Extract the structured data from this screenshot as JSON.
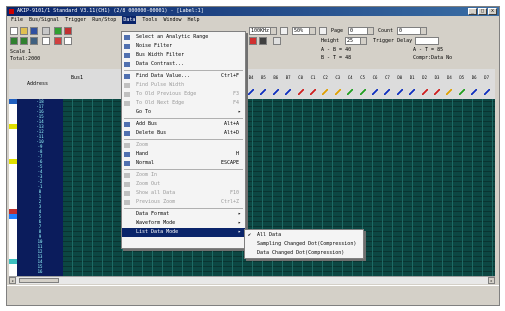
{
  "window": {
    "title": "AKIP-9101/1 Standard V3.11(CH1) (2/8 000000-00001) - [Label:1]",
    "min": "_",
    "max": "□",
    "close": "x"
  },
  "menubar": [
    "File",
    "Bus/Signal",
    "Trigger",
    "Run/Stop",
    "Data",
    "Tools",
    "Window",
    "Help"
  ],
  "toolbar": {
    "freq": "100KHz",
    "zoom": "50%",
    "page_label": "Page",
    "page_value": "0",
    "count_label": "Count",
    "count_value": "0",
    "height_label": "Height",
    "height_value": "25",
    "trigger_delay_label": "Trigger Delay",
    "scale_label": "Scale 1",
    "total_label": "Total:2000",
    "cursor_ab": "A - B = 40",
    "cursor_ot": "B - T = 48",
    "cursor_at": "A - T = 85",
    "compress": "Compr:Data No"
  },
  "grid": {
    "address_header": "Address",
    "data_header": "Bus1",
    "channels": [
      "B4",
      "B5",
      "B6",
      "B7",
      "C0",
      "C1",
      "C2",
      "C3",
      "C4",
      "C5",
      "C6",
      "C7",
      "D0",
      "D1",
      "D2",
      "D3",
      "D4",
      "D5",
      "D6",
      "D7"
    ],
    "pencil_colors": [
      "#1030c0",
      "#1030c0",
      "#1030c0",
      "#1030c0",
      "#d02020",
      "#d02020",
      "#e0a000",
      "#e0a000",
      "#20a020",
      "#20a020",
      "#1030c0",
      "#1030c0",
      "#1030c0",
      "#1030c0",
      "#d02020",
      "#d02020",
      "#e0a000",
      "#20a020",
      "#1030c0",
      "#1030c0"
    ],
    "rows": [
      "-18",
      "-17",
      "-16",
      "-15",
      "-14",
      "-13",
      "-12",
      "-11",
      "-10",
      "-9",
      "-8",
      "-7",
      "-6",
      "-5",
      "-4",
      "-3",
      "-2",
      "-1",
      "0",
      "1",
      "2",
      "3",
      "4",
      "5",
      "6",
      "7",
      "8",
      "9",
      "10",
      "11",
      "12",
      "13",
      "14",
      "15",
      "16"
    ]
  },
  "menu": {
    "items": [
      {
        "label": "Select an Analytic Range",
        "shortcut": "",
        "state": "normal",
        "icon": "range-icon"
      },
      {
        "label": "Noise Filter",
        "shortcut": "",
        "state": "normal",
        "icon": "filter-icon"
      },
      {
        "label": "Bus Width Filter",
        "shortcut": "",
        "state": "normal",
        "icon": "bus-filter-icon"
      },
      {
        "label": "Data Contrast...",
        "shortcut": "",
        "state": "normal",
        "icon": "contrast-icon"
      },
      {
        "label": "Find Data Value...",
        "shortcut": "Ctrl+F",
        "state": "normal",
        "icon": "find-icon"
      },
      {
        "label": "Find Pulse Width",
        "shortcut": "",
        "state": "disabled",
        "icon": "pulse-icon"
      },
      {
        "label": "To Old Previous Edge",
        "shortcut": "F3",
        "state": "disabled",
        "icon": "prev-edge-icon"
      },
      {
        "label": "To Old Next Edge",
        "shortcut": "F4",
        "state": "disabled",
        "icon": "next-edge-icon"
      },
      {
        "label": "Go To",
        "shortcut": "",
        "state": "normal",
        "icon": "",
        "submenu": true
      },
      {
        "label": "Add Bus",
        "shortcut": "Alt+A",
        "state": "normal",
        "icon": "add-bus-icon"
      },
      {
        "label": "Delete Bus",
        "shortcut": "Alt+D",
        "state": "normal",
        "icon": "delete-bus-icon"
      },
      {
        "label": "Zoom",
        "shortcut": "",
        "state": "disabled",
        "icon": "zoom-icon"
      },
      {
        "label": "Hand",
        "shortcut": "H",
        "state": "normal",
        "icon": "hand-icon"
      },
      {
        "label": "Normal",
        "shortcut": "ESCAPE",
        "state": "normal",
        "icon": "normal-icon"
      },
      {
        "label": "Zoom In",
        "shortcut": "",
        "state": "disabled",
        "icon": "zoom-in-icon"
      },
      {
        "label": "Zoom Out",
        "shortcut": "",
        "state": "disabled",
        "icon": "zoom-out-icon"
      },
      {
        "label": "Show all Data",
        "shortcut": "F10",
        "state": "disabled",
        "icon": "show-all-icon"
      },
      {
        "label": "Previous Zoom",
        "shortcut": "Ctrl+Z",
        "state": "disabled",
        "icon": "prev-zoom-icon"
      },
      {
        "label": "Data Format",
        "shortcut": "",
        "state": "normal",
        "icon": "",
        "submenu": true
      },
      {
        "label": "Waveform Mode",
        "shortcut": "",
        "state": "normal",
        "icon": "",
        "submenu": true
      },
      {
        "label": "List Data Mode",
        "shortcut": "",
        "state": "selected",
        "icon": "",
        "submenu": true
      }
    ],
    "submenu_arrow": "▸"
  },
  "submenu": {
    "check": "✔",
    "items": [
      {
        "label": "All Data",
        "checked": true
      },
      {
        "label": "Sampling Changed Dot(Compression)",
        "checked": false
      },
      {
        "label": "Data Changed Dot(Compression)",
        "checked": false
      }
    ]
  }
}
